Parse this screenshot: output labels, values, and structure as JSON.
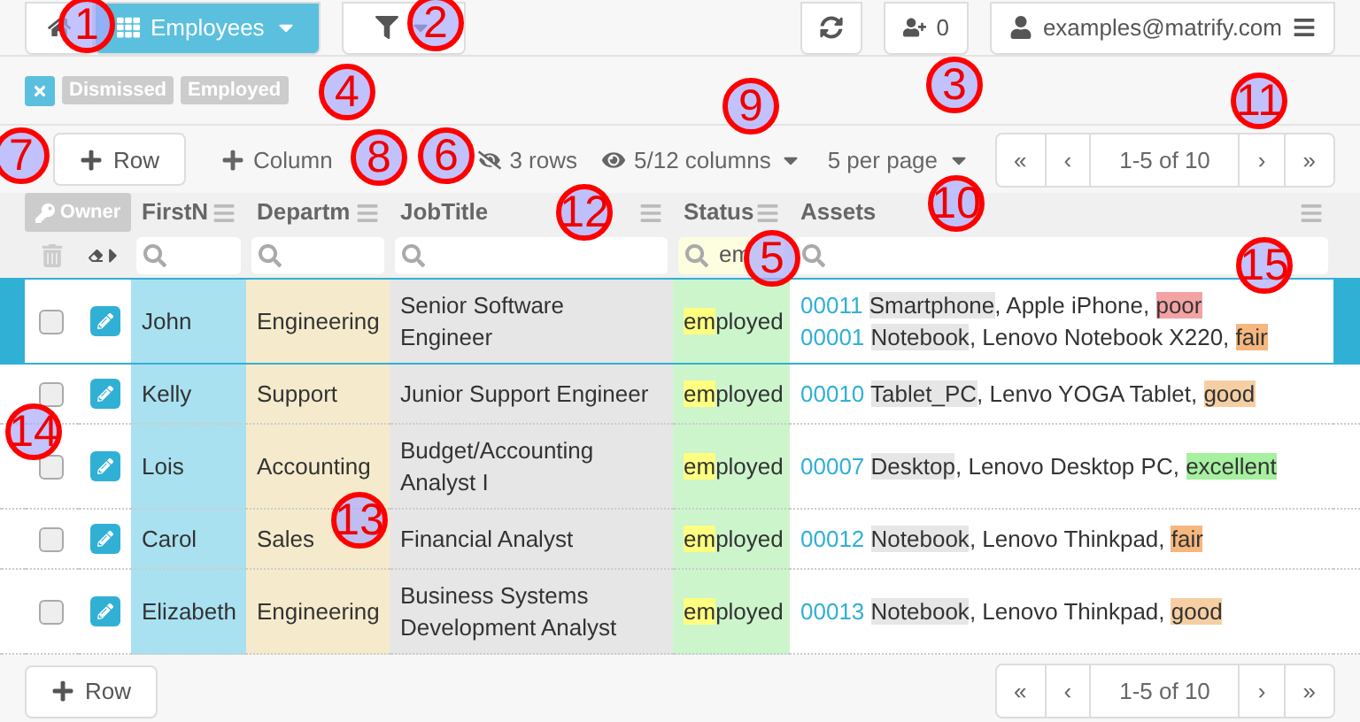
{
  "toolbar": {
    "view": "Employees",
    "user": "examples@matrify.com",
    "invites": "0"
  },
  "filter_tags": [
    {
      "label": "Dismissed",
      "selected": false
    },
    {
      "label": "Employed",
      "selected": false
    }
  ],
  "actions": {
    "add_row": "Row",
    "add_column": "Column",
    "rows": "3 rows",
    "columns": "5/12 columns",
    "per_page": "5 per page",
    "range": "1-5 of 10"
  },
  "pager": {
    "first": "«",
    "previous": "‹",
    "next": "›",
    "last": "»"
  },
  "table": {
    "owner": "Owner",
    "columns": [
      {
        "label": "FirstN"
      },
      {
        "label": "Departm"
      },
      {
        "label": "JobTitle"
      },
      {
        "label": "Status",
        "filter": "em"
      },
      {
        "label": "Assets"
      }
    ],
    "rows": [
      {
        "selected": true,
        "checked": false,
        "first": "John",
        "dept": "Engineering",
        "title": "Senior Software Engineer",
        "status": [
          "em",
          "ployed"
        ],
        "assets": [
          {
            "id": "00011",
            "type": "Smartphone",
            "name": ", Apple iPhone, ",
            "condition": "poor",
            "color": "#f2a3a3"
          },
          {
            "id": "00001",
            "type": "Notebook",
            "name": ", Lenovo Notebook X220, ",
            "condition": "fair",
            "color": "#f5b77e"
          }
        ]
      },
      {
        "selected": false,
        "checked": false,
        "first": "Kelly",
        "dept": "Support",
        "title": "Junior Support Engineer",
        "status": [
          "em",
          "ployed"
        ],
        "assets": [
          {
            "id": "00010",
            "type": "Tablet_PC",
            "name": ", Lenvo YOGA Tablet, ",
            "condition": "good",
            "color": "#f5cfa3"
          }
        ]
      },
      {
        "selected": false,
        "checked": false,
        "first": "Lois",
        "dept": "Accounting",
        "title": "Budget/Accounting Analyst I",
        "status": [
          "em",
          "ployed"
        ],
        "assets": [
          {
            "id": "00007",
            "type": "Desktop",
            "name": ", Lenovo Desktop PC, ",
            "condition": "excellent",
            "color": "#a6f0a0"
          }
        ]
      },
      {
        "selected": false,
        "checked": false,
        "first": "Carol",
        "dept": "Sales",
        "title": "Financial Analyst",
        "status": [
          "em",
          "ployed"
        ],
        "assets": [
          {
            "id": "00012",
            "type": "Notebook",
            "name": ", Lenovo Thinkpad, ",
            "condition": "fair",
            "color": "#f5b77e"
          }
        ]
      },
      {
        "selected": false,
        "checked": false,
        "first": "Elizabeth",
        "dept": "Engineering",
        "title": "Business Systems Development Analyst",
        "status": [
          "em",
          "ployed"
        ],
        "assets": [
          {
            "id": "00013",
            "type": "Notebook",
            "name": ", Lenovo Thinkpad, ",
            "condition": "good",
            "color": "#f5cfa3"
          }
        ]
      }
    ]
  },
  "footer": {
    "add_row": "Row",
    "range": "1-5 of 10"
  },
  "annotations": [
    "1",
    "2",
    "4",
    "3",
    "9",
    "11",
    "7",
    "8",
    "6",
    "10",
    "12",
    "5",
    "15",
    "14",
    "13"
  ]
}
